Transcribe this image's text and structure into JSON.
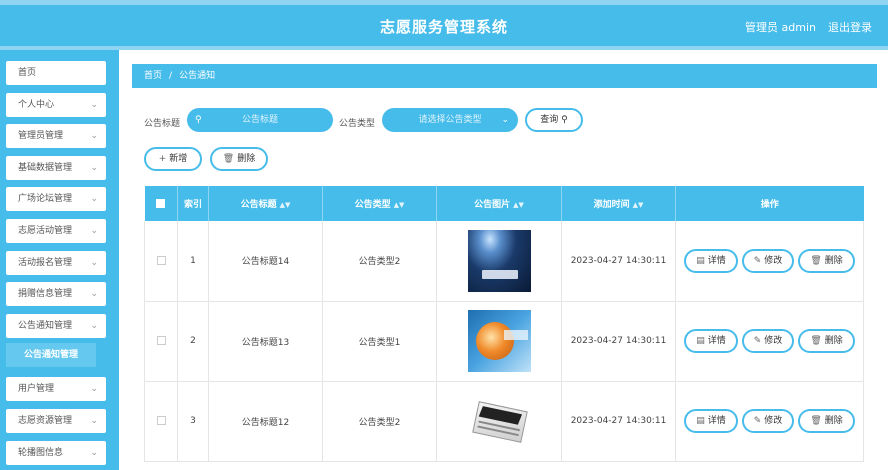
{
  "header": {
    "title": "志愿服务管理系统",
    "admin_label": "管理员 admin",
    "logout_label": "退出登录"
  },
  "sidebar": {
    "items": [
      {
        "label": "首页",
        "chevron": false
      },
      {
        "label": "个人中心",
        "chevron": true
      },
      {
        "label": "管理员管理",
        "chevron": true
      },
      {
        "label": "基础数据管理",
        "chevron": true
      },
      {
        "label": "广场论坛管理",
        "chevron": true
      },
      {
        "label": "志愿活动管理",
        "chevron": true
      },
      {
        "label": "活动报名管理",
        "chevron": true
      },
      {
        "label": "捐赠信息管理",
        "chevron": true
      },
      {
        "label": "公告通知管理",
        "chevron": true
      }
    ],
    "active_sub": "公告通知管理",
    "items_after": [
      {
        "label": "用户管理",
        "chevron": true
      },
      {
        "label": "志愿资源管理",
        "chevron": true
      },
      {
        "label": "轮播图信息",
        "chevron": true
      }
    ]
  },
  "breadcrumb": {
    "home": "首页",
    "separator": "/",
    "current": "公告通知"
  },
  "search": {
    "title_label": "公告标题",
    "title_placeholder": "公告标题",
    "type_label": "公告类型",
    "type_placeholder": "请选择公告类型",
    "query_label": "查询"
  },
  "actions": {
    "add_label": "新增",
    "delete_label": "删除"
  },
  "table": {
    "headers": {
      "index": "索引",
      "title": "公告标题",
      "type": "公告类型",
      "image": "公告图片",
      "time": "添加时间",
      "ops": "操作"
    },
    "rows": [
      {
        "index": "1",
        "title": "公告标题14",
        "type": "公告类型2",
        "image_icon": "spotlight-news-image",
        "time": "2023-04-27 14:30:11"
      },
      {
        "index": "2",
        "title": "公告标题13",
        "type": "公告类型1",
        "image_icon": "globe-news-image",
        "time": "2023-04-27 14:30:11"
      },
      {
        "index": "3",
        "title": "公告标题12",
        "type": "公告类型2",
        "image_icon": "newspaper-image",
        "time": "2023-04-27 14:30:11"
      }
    ],
    "op_labels": {
      "detail": "详情",
      "edit": "修改",
      "delete": "删除"
    }
  },
  "colors": {
    "primary": "#46bcea",
    "light": "#8fd5f2"
  }
}
